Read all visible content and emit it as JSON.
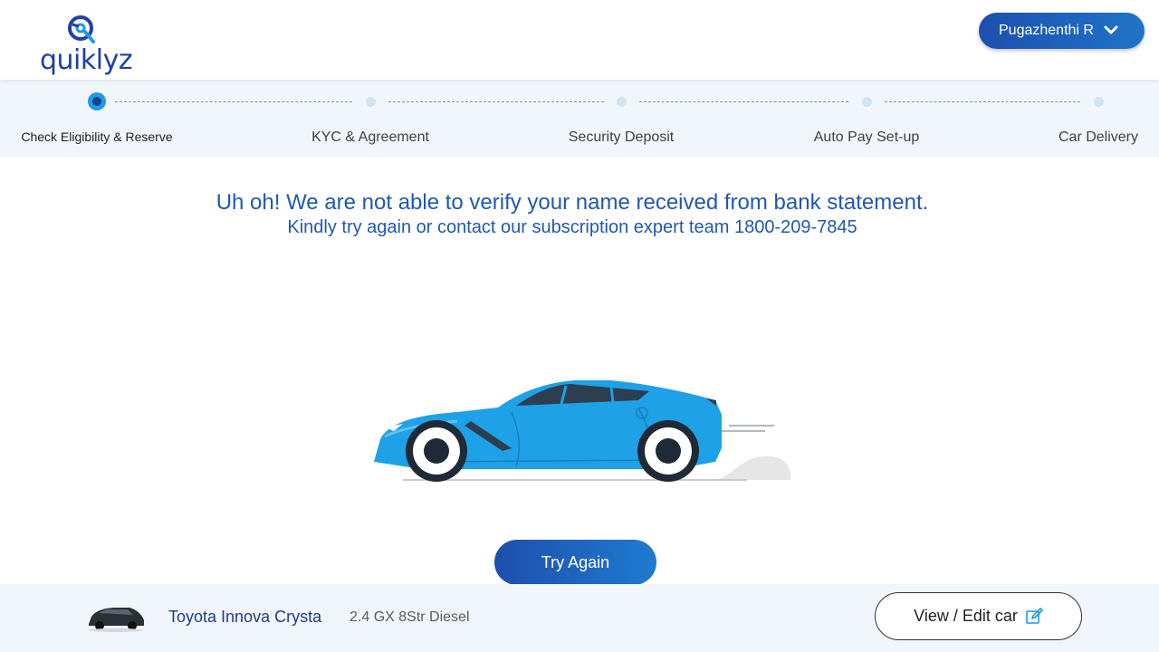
{
  "header": {
    "logo_text": "quiklyz",
    "user_name": "Pugazhenthi R"
  },
  "stepper": {
    "steps": [
      {
        "label": "Check Eligibility & Reserve",
        "active": true
      },
      {
        "label": "KYC & Agreement",
        "active": false
      },
      {
        "label": "Security Deposit",
        "active": false
      },
      {
        "label": "Auto Pay Set-up",
        "active": false
      },
      {
        "label": "Car Delivery",
        "active": false
      }
    ]
  },
  "main": {
    "error_title": "Uh oh! We are not able to verify your name received from bank statement.",
    "error_subtitle": "Kindly try again or contact our subscription expert team 1800-209-7845",
    "try_again_label": "Try Again"
  },
  "footer": {
    "car_name": "Toyota Innova Crysta",
    "car_variant": "2.4 GX 8Str Diesel",
    "view_edit_label": "View / Edit car"
  },
  "colors": {
    "brand_blue": "#2058b0",
    "accent_blue": "#1f9be0",
    "car_body": "#1ea1e6"
  }
}
